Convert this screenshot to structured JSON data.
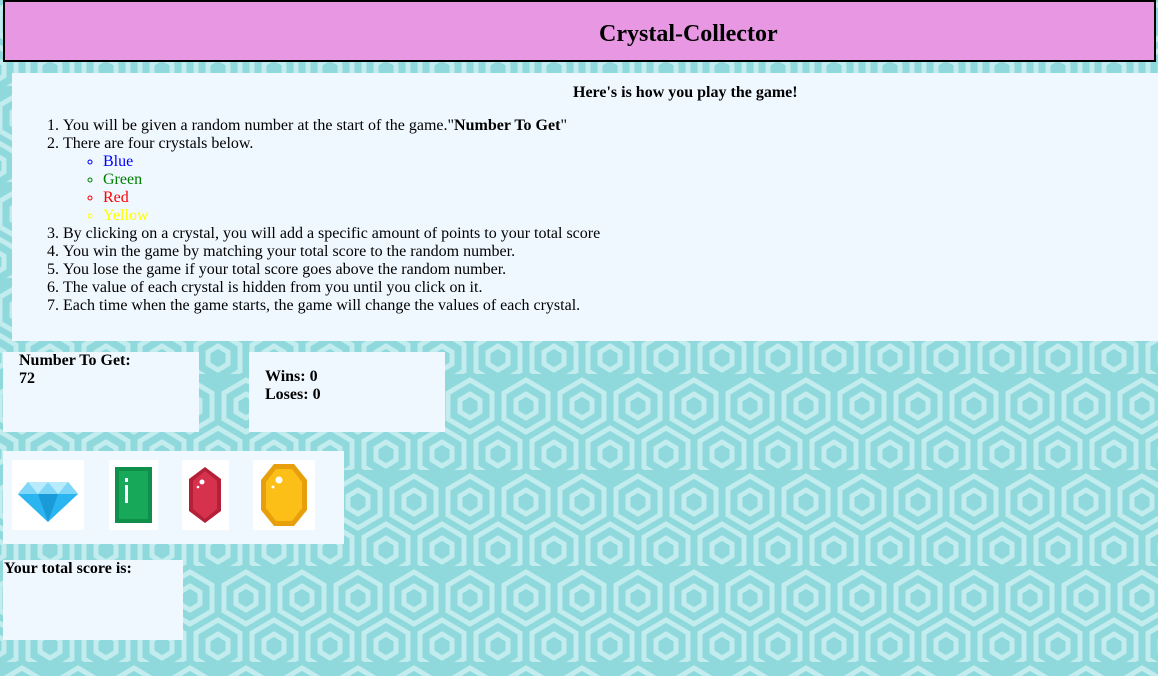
{
  "header": {
    "title": "Crystal-Collector"
  },
  "instructions": {
    "heading": "Here's is how you play the game!",
    "step1_text": "You will be given a random number at the start of the game.\"",
    "step1_bold": "Number To Get",
    "step1_end": "\"",
    "step2": "There are four crystals below.",
    "crystal_names": [
      {
        "label": "Blue",
        "color": "#0000ff"
      },
      {
        "label": "Green",
        "color": "#008000"
      },
      {
        "label": "Red",
        "color": "#ff0000"
      },
      {
        "label": "Yellow",
        "color": "#ffff00"
      }
    ],
    "step3": "By clicking on a crystal, you will add a specific amount of points to your total score",
    "step4": "You win the game by matching your total score to the random number.",
    "step5": "You lose the game if your total score goes above the random number.",
    "step6": "The value of each crystal is hidden from you until you click on it.",
    "step7": "Each time when the game starts, the game will change the values of each crystal."
  },
  "target": {
    "label": "Number To Get:",
    "value": "72"
  },
  "stats": {
    "wins_label": "Wins:",
    "wins": "0",
    "loses_label": "Loses:",
    "loses": "0"
  },
  "crystals": [
    {
      "name": "blue-diamond-crystal",
      "icon": "diamond",
      "color": "#2bb5f0"
    },
    {
      "name": "green-crystal",
      "icon": "emerald",
      "color": "#17a85a"
    },
    {
      "name": "red-crystal",
      "icon": "ruby",
      "color": "#d6324d"
    },
    {
      "name": "yellow-crystal",
      "icon": "topaz",
      "color": "#fbbf17"
    }
  ],
  "score": {
    "label": "Your total score is:",
    "value": ""
  },
  "colors": {
    "header_bg": "#e897e2",
    "panel_bg": "#f0f8ff",
    "page_bg": "#8fd9dc"
  }
}
